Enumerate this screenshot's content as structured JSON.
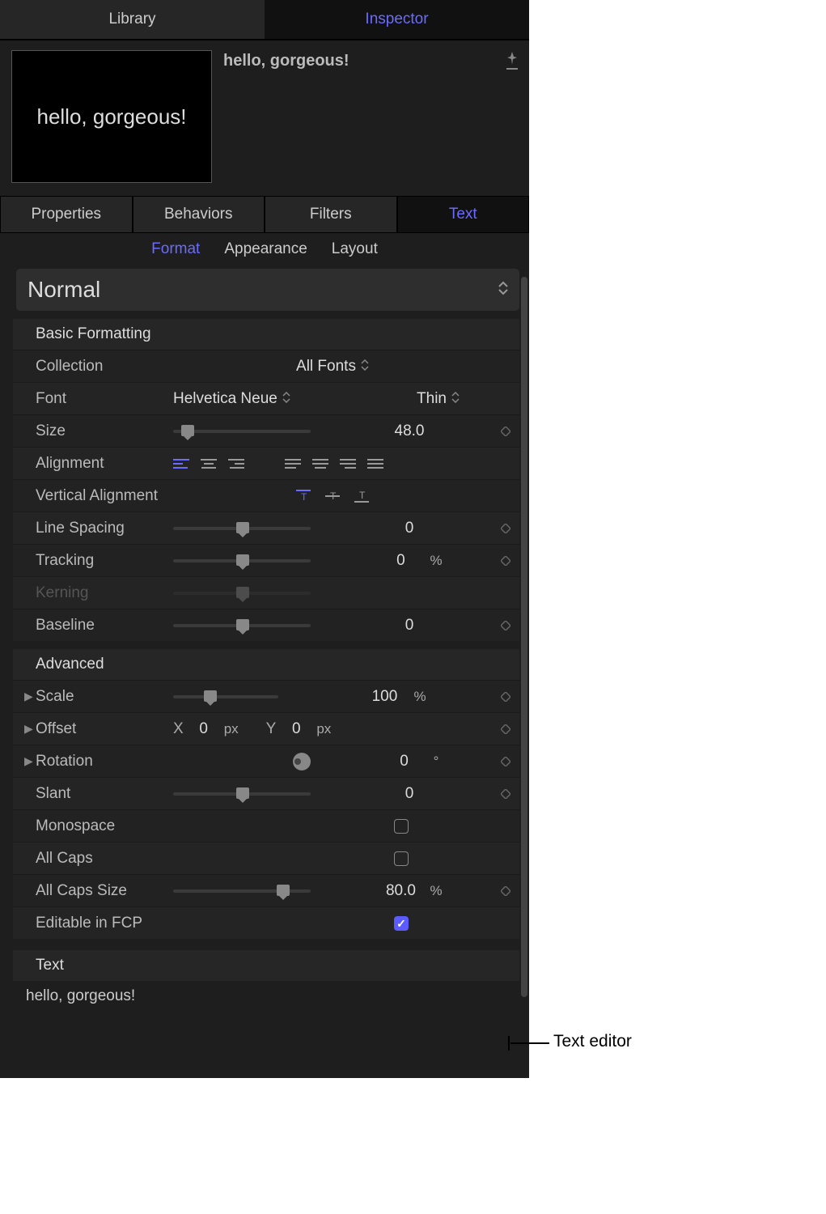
{
  "tabs": {
    "library": "Library",
    "inspector": "Inspector"
  },
  "item": {
    "title": "hello, gorgeous!",
    "preview_text": "hello, gorgeous!"
  },
  "midtabs": {
    "properties": "Properties",
    "behaviors": "Behaviors",
    "filters": "Filters",
    "text": "Text"
  },
  "subtabs": {
    "format": "Format",
    "appearance": "Appearance",
    "layout": "Layout"
  },
  "preset": "Normal",
  "sections": {
    "basic": "Basic Formatting",
    "advanced": "Advanced",
    "text": "Text"
  },
  "labels": {
    "collection": "Collection",
    "font": "Font",
    "size": "Size",
    "alignment": "Alignment",
    "valign": "Vertical Alignment",
    "linespacing": "Line Spacing",
    "tracking": "Tracking",
    "kerning": "Kerning",
    "baseline": "Baseline",
    "scale": "Scale",
    "offset": "Offset",
    "rotation": "Rotation",
    "slant": "Slant",
    "monospace": "Monospace",
    "allcaps": "All Caps",
    "allcapssize": "All Caps Size",
    "editablefcp": "Editable in FCP"
  },
  "values": {
    "collection": "All Fonts",
    "font_family": "Helvetica Neue",
    "font_style": "Thin",
    "size": "48.0",
    "linespacing": "0",
    "tracking": "0",
    "baseline": "0",
    "scale": "100",
    "offset_x": "0",
    "offset_y": "0",
    "rotation": "0",
    "slant": "0",
    "allcapssize": "80.0"
  },
  "units": {
    "px": "px",
    "pct": "%",
    "deg": "°",
    "x": "X",
    "y": "Y"
  },
  "text_content": "hello, gorgeous!",
  "annotation": "Text editor"
}
